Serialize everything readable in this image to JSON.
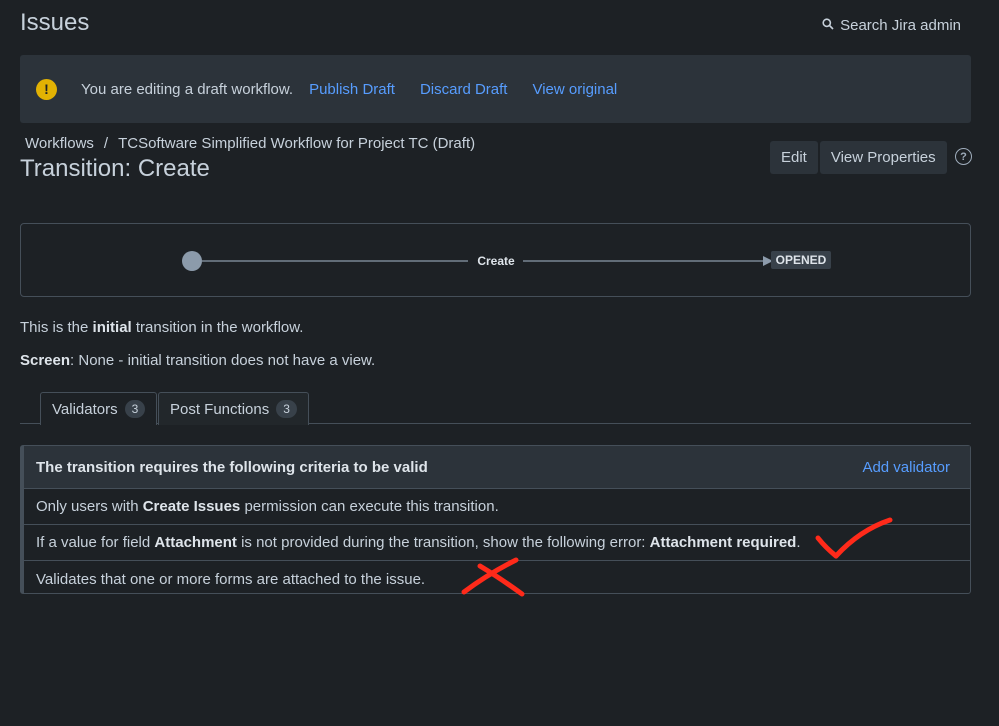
{
  "header": {
    "title": "Issues",
    "search_label": "Search Jira admin"
  },
  "banner": {
    "text": "You are editing a draft workflow.",
    "publish": "Publish Draft",
    "discard": "Discard Draft",
    "view_original": "View original"
  },
  "breadcrumb": {
    "workflows": "Workflows",
    "separator": "/",
    "current": "TCSoftware Simplified Workflow for Project TC (Draft)"
  },
  "page": {
    "heading": "Transition: Create",
    "edit": "Edit",
    "view_properties": "View Properties",
    "help": "?"
  },
  "diagram": {
    "transition_label": "Create",
    "target_status": "OPENED"
  },
  "info": {
    "line1_pre": "This is the ",
    "line1_bold": "initial",
    "line1_post": " transition in the workflow.",
    "line2_bold": "Screen",
    "line2_post": ": None - initial transition does not have a view."
  },
  "tabs": [
    {
      "label": "Validators",
      "count": "3"
    },
    {
      "label": "Post Functions",
      "count": "3"
    }
  ],
  "validators": {
    "header": "The transition requires the following criteria to be valid",
    "add": "Add validator",
    "rows": [
      {
        "pre": "Only users with ",
        "bold": "Create Issues",
        "post": " permission can execute this transition."
      },
      {
        "pre": "If a value for field ",
        "bold": "Attachment",
        "mid": " is not provided during the transition, show the following error: ",
        "bold2": "Attachment required",
        "post": "."
      },
      {
        "text": "Validates that one or more forms are attached to the issue."
      }
    ]
  },
  "colors": {
    "background": "#1d2125",
    "accent_link": "#579dff",
    "warning": "#e2b203",
    "annotation": "#ff2a1a"
  }
}
